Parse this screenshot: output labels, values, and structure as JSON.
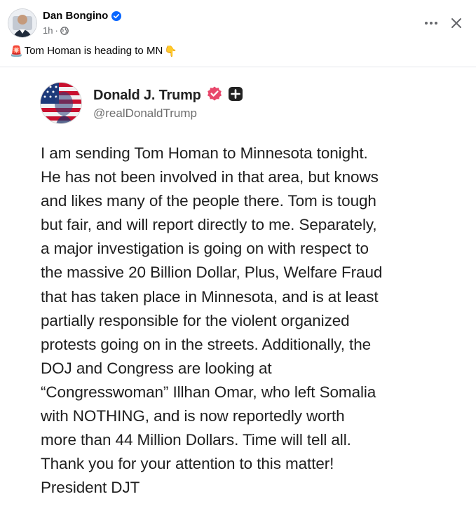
{
  "post": {
    "author": {
      "name": "Dan Bongino",
      "verified": true,
      "avatar_icon": "author-avatar"
    },
    "meta": {
      "time": "1h",
      "separator": "·",
      "audience_icon": "globe-icon"
    },
    "actions": {
      "more_icon": "more-horizontal-icon",
      "close_icon": "close-icon"
    },
    "caption": {
      "leading_emoji": "🚨",
      "text": "Tom Homan is heading to MN",
      "trailing_emoji": "👇"
    }
  },
  "embedded_post": {
    "author_name": "Donald J. Trump",
    "handle": "@realDonaldTrump",
    "badges": [
      "verified-badge-icon",
      "plus-badge-icon"
    ],
    "text": "I am sending Tom Homan to Minnesota tonight.\nHe has not been involved in that area, but knows\nand likes many of the people there. Tom is tough\nbut fair, and will report directly to me. Separately,\na major investigation is going on with respect to\nthe massive 20 Billion Dollar, Plus, Welfare Fraud\nthat has taken place in Minnesota, and is at least\npartially responsible for the violent organized\nprotests going on in the streets. Additionally, the\nDOJ and Congress are looking at\n“Congresswoman” Illhan Omar, who left Somalia\nwith NOTHING, and is now reportedly worth\nmore than 44 Million Dollars. Time will tell all.\nThank you for your attention to this matter!\nPresident DJT"
  },
  "colors": {
    "facebook_blue": "#0866ff",
    "secondary_text": "#65676b",
    "divider": "#e4e6eb",
    "truth_badge": "#e8476b",
    "plus_badge": "#222222"
  }
}
